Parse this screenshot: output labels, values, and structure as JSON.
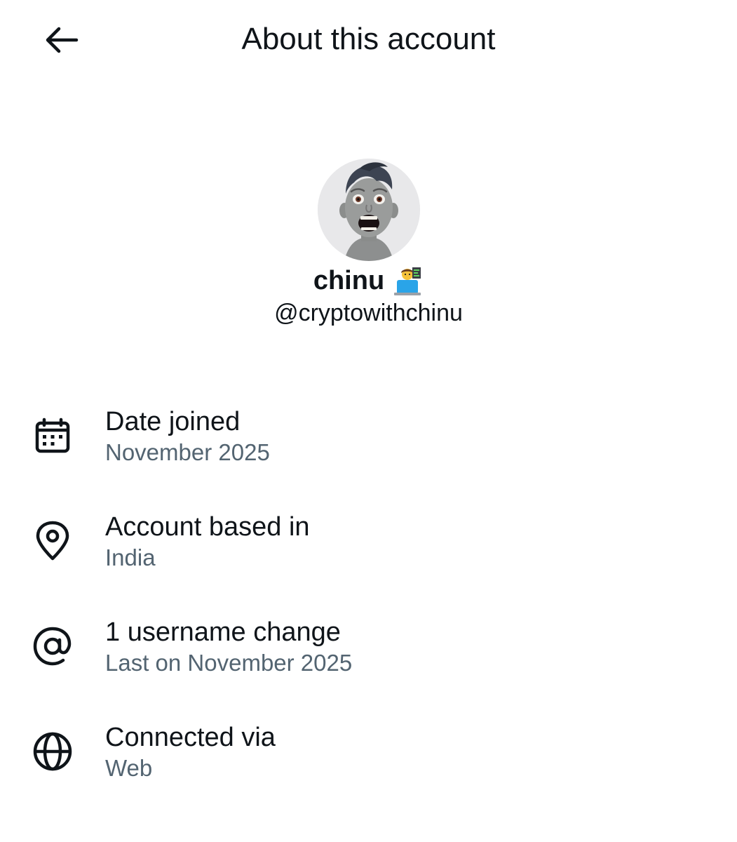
{
  "header": {
    "back_icon": "arrow-left-icon",
    "title": "About this account"
  },
  "profile": {
    "avatar_icon": "cartoon-avatar",
    "display_name": "chinu",
    "name_emoji": "technologist-emoji",
    "handle": "@cryptowithchinu"
  },
  "info": {
    "date_joined": {
      "icon": "calendar-icon",
      "title": "Date joined",
      "value": "November 2025"
    },
    "based_in": {
      "icon": "location-pin-icon",
      "title": "Account based in",
      "value": "India"
    },
    "username_changes": {
      "icon": "at-sign-icon",
      "title": "1 username change",
      "value": "Last on November 2025"
    },
    "connected_via": {
      "icon": "globe-icon",
      "title": "Connected via",
      "value": "Web"
    }
  },
  "colors": {
    "primary_text": "#0f1419",
    "secondary_text": "#536471",
    "background": "#ffffff"
  }
}
